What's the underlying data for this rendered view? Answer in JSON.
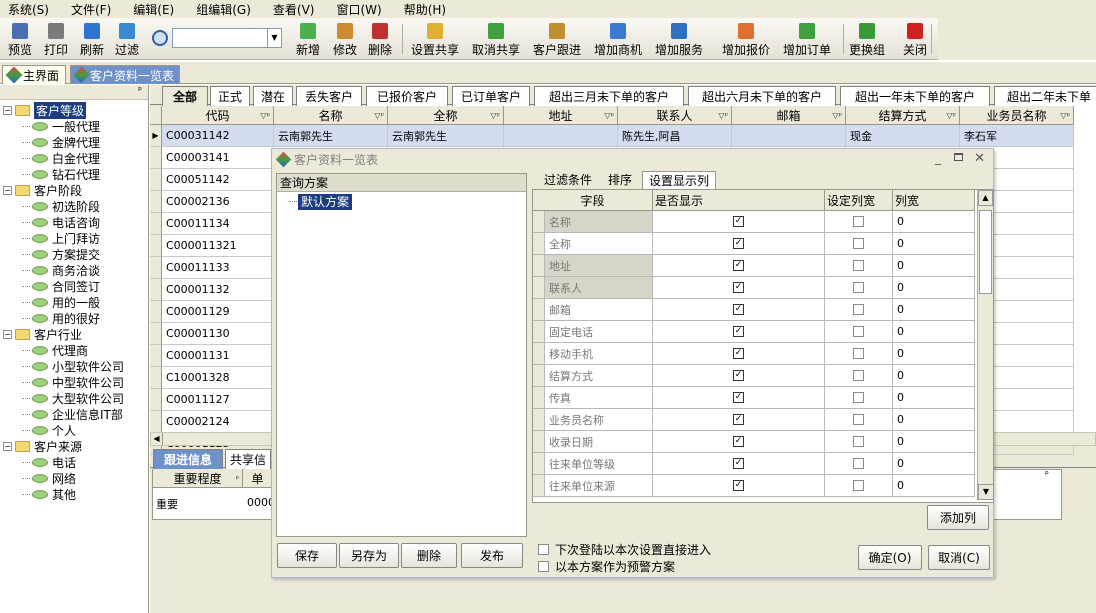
{
  "menu": [
    "系统(S)",
    "文件(F)",
    "编辑(E)",
    "组编辑(G)",
    "查看(V)",
    "窗口(W)",
    "帮助(H)"
  ],
  "toolbar": {
    "left": [
      {
        "label": "预览",
        "icon": "preview-icon",
        "color": "#4a6fb0"
      },
      {
        "label": "打印",
        "icon": "printer-icon",
        "color": "#7a7a7a"
      },
      {
        "label": "刷新",
        "icon": "refresh-icon",
        "color": "#2f72d0"
      },
      {
        "label": "过滤",
        "icon": "filter-icon",
        "color": "#3a8ad0"
      }
    ],
    "search": {
      "value": ""
    },
    "right": [
      {
        "label": "新增",
        "icon": "new-document-icon",
        "color": "#4caf50"
      },
      {
        "label": "修改",
        "icon": "edit-icon",
        "color": "#d08a2f"
      },
      {
        "label": "删除",
        "icon": "delete-icon",
        "color": "#c03030"
      },
      {
        "label": "设置共享",
        "icon": "share-folder-icon",
        "color": "#e0b030"
      },
      {
        "label": "取消共享",
        "icon": "unshare-icon",
        "color": "#40a040"
      },
      {
        "label": "客户跟进",
        "icon": "customer-follow-icon",
        "color": "#c09030"
      },
      {
        "label": "增加商机",
        "icon": "home-add-icon",
        "color": "#3a7ad0"
      },
      {
        "label": "增加服务",
        "icon": "service-icon",
        "color": "#3070c0"
      },
      {
        "label": "增加报价",
        "icon": "quote-icon",
        "color": "#e07030"
      },
      {
        "label": "增加订单",
        "icon": "order-icon",
        "color": "#40a040"
      },
      {
        "label": "更换组",
        "icon": "change-group-icon",
        "color": "#3a9a3a"
      },
      {
        "label": "关闭",
        "icon": "close-icon",
        "color": "#d02020"
      }
    ]
  },
  "doc_tabs": [
    {
      "label": "主界面",
      "active": false
    },
    {
      "label": "客户资料一览表",
      "active": true
    }
  ],
  "tree": [
    {
      "label": "客户等级",
      "level": 0,
      "selected": true
    },
    {
      "label": "一般代理",
      "level": 1
    },
    {
      "label": "金牌代理",
      "level": 1
    },
    {
      "label": "白金代理",
      "level": 1
    },
    {
      "label": "钻石代理",
      "level": 1
    },
    {
      "label": "客户阶段",
      "level": 0
    },
    {
      "label": "初选阶段",
      "level": 1
    },
    {
      "label": "电话咨询",
      "level": 1
    },
    {
      "label": "上门拜访",
      "level": 1
    },
    {
      "label": "方案提交",
      "level": 1
    },
    {
      "label": "商务洽谈",
      "level": 1
    },
    {
      "label": "合同签订",
      "level": 1
    },
    {
      "label": "用的一般",
      "level": 1
    },
    {
      "label": "用的很好",
      "level": 1
    },
    {
      "label": "客户行业",
      "level": 0
    },
    {
      "label": "代理商",
      "level": 1
    },
    {
      "label": "小型软件公司",
      "level": 1
    },
    {
      "label": "中型软件公司",
      "level": 1
    },
    {
      "label": "大型软件公司",
      "level": 1
    },
    {
      "label": "企业信息IT部",
      "level": 1
    },
    {
      "label": "个人",
      "level": 1
    },
    {
      "label": "客户来源",
      "level": 0
    },
    {
      "label": "电话",
      "level": 1
    },
    {
      "label": "网络",
      "level": 1
    },
    {
      "label": "其他",
      "level": 1
    }
  ],
  "sub_tabs": [
    "全部",
    "正式",
    "潜在",
    "丢失客户",
    "已报价客户",
    "已订单客户",
    "超出三月未下单的客户",
    "超出六月未下单的客户",
    "超出一年未下单的客户",
    "超出二年未下单"
  ],
  "grid": {
    "columns": [
      "代码",
      "名称",
      "全称",
      "地址",
      "联系人",
      "邮箱",
      "结算方式",
      "业务员名称"
    ],
    "rows": [
      [
        "C00031142",
        "云南郭先生",
        "云南郭先生",
        "",
        "陈先生,阿昌",
        "",
        "现金",
        "李石军"
      ],
      [
        "C00003141",
        "",
        "",
        "",
        "",
        "",
        "",
        ""
      ],
      [
        "C00051142",
        "",
        "",
        "",
        "",
        "",
        "",
        ""
      ],
      [
        "C00002136",
        "",
        "",
        "",
        "",
        "",
        "",
        ""
      ],
      [
        "C00011134",
        "",
        "",
        "",
        "",
        "",
        "",
        ""
      ],
      [
        "C000011321",
        "",
        "",
        "",
        "",
        "",
        "",
        ""
      ],
      [
        "C00011133",
        "",
        "",
        "",
        "",
        "",
        "",
        ""
      ],
      [
        "C00001132",
        "",
        "",
        "",
        "",
        "",
        "",
        ""
      ],
      [
        "C00001129",
        "",
        "",
        "",
        "",
        "",
        "",
        ""
      ],
      [
        "C00001130",
        "",
        "",
        "",
        "",
        "",
        "",
        ""
      ],
      [
        "C00001131",
        "",
        "",
        "",
        "",
        "",
        "",
        ""
      ],
      [
        "C10001328",
        "",
        "",
        "",
        "",
        "",
        "",
        ""
      ],
      [
        "C00011127",
        "",
        "",
        "",
        "",
        "",
        "",
        ""
      ],
      [
        "C00002124",
        "",
        "",
        "",
        "",
        "",
        "",
        ""
      ],
      [
        "C00001125",
        "",
        "",
        "",
        "",
        "",
        "",
        ""
      ]
    ]
  },
  "bottom": {
    "tabs": [
      "跟进信息",
      "共享信"
    ],
    "columns": [
      "重要程度",
      "单"
    ],
    "row": [
      "重要",
      "0000"
    ]
  },
  "dialog": {
    "title": "客户资料一览表",
    "scheme_header": "查询方案",
    "scheme_item": "默认方案",
    "left_buttons": [
      "保存",
      "另存为",
      "删除",
      "发布"
    ],
    "tabs": [
      "过滤条件",
      "排序",
      "设置显示列"
    ],
    "field_headers": [
      "字段",
      "是否显示",
      "设定列宽",
      "列宽"
    ],
    "fields": [
      {
        "name": "名称",
        "show": true,
        "set": false,
        "width": "0",
        "locked": true
      },
      {
        "name": "全称",
        "show": true,
        "set": false,
        "width": "0",
        "locked": false
      },
      {
        "name": "地址",
        "show": true,
        "set": false,
        "width": "0",
        "locked": true
      },
      {
        "name": "联系人",
        "show": true,
        "set": false,
        "width": "0",
        "locked": true
      },
      {
        "name": "邮箱",
        "show": true,
        "set": false,
        "width": "0",
        "locked": false
      },
      {
        "name": "固定电话",
        "show": true,
        "set": false,
        "width": "0",
        "locked": false
      },
      {
        "name": "移动手机",
        "show": true,
        "set": false,
        "width": "0",
        "locked": false
      },
      {
        "name": "结算方式",
        "show": true,
        "set": false,
        "width": "0",
        "locked": false
      },
      {
        "name": "传真",
        "show": true,
        "set": false,
        "width": "0",
        "locked": false
      },
      {
        "name": "业务员名称",
        "show": true,
        "set": false,
        "width": "0",
        "locked": false
      },
      {
        "name": "收录日期",
        "show": true,
        "set": false,
        "width": "0",
        "locked": false
      },
      {
        "name": "往来单位等级",
        "show": true,
        "set": false,
        "width": "0",
        "locked": false
      },
      {
        "name": "往来单位来源",
        "show": true,
        "set": false,
        "width": "0",
        "locked": false
      }
    ],
    "add_column": "添加列",
    "checkbox1": "下次登陆以本次设置直接进入",
    "checkbox2": "以本方案作为预警方案",
    "ok": "确定(O)",
    "cancel": "取消(C)"
  }
}
